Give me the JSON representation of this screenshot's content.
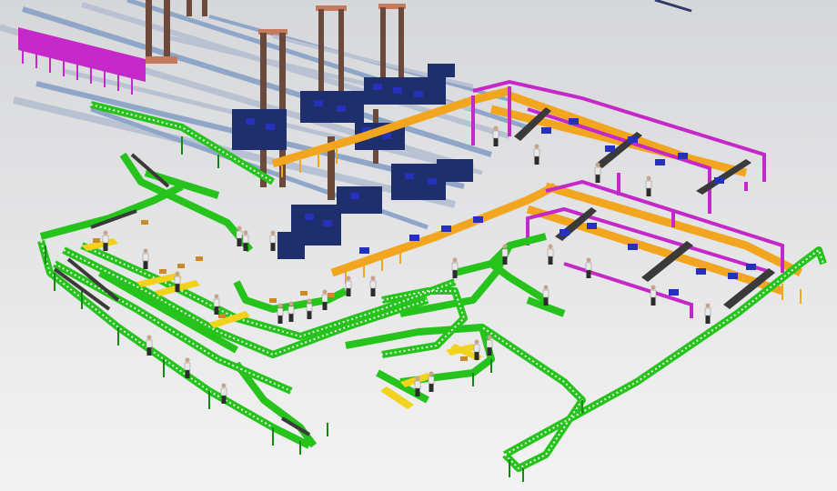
{
  "scene": {
    "kind": "3D render of a warehouse conveyor sorting system",
    "colors": {
      "background_top": "#d6d7d9",
      "background_bottom": "#f3f3f3",
      "conveyor_green": "#27c31d",
      "conveyor_green_dark": "#158a12",
      "conveyor_magenta": "#c528c8",
      "conveyor_orange": "#f2a51f",
      "roller_light": "#e8efe8",
      "lane_blue": "#8fa6c9",
      "lane_gray": "#b9c2d2",
      "column_brown": "#6b4a3c",
      "station_navy": "#1f2f6d",
      "tote_blue": "#2431b8",
      "table_yellow": "#f2d21b",
      "belt_dark": "#3a3a3a",
      "worker_shirt": "#e9e9e9",
      "worker_pants": "#2c2c2c"
    },
    "workers_count": 31,
    "text_labels": []
  }
}
